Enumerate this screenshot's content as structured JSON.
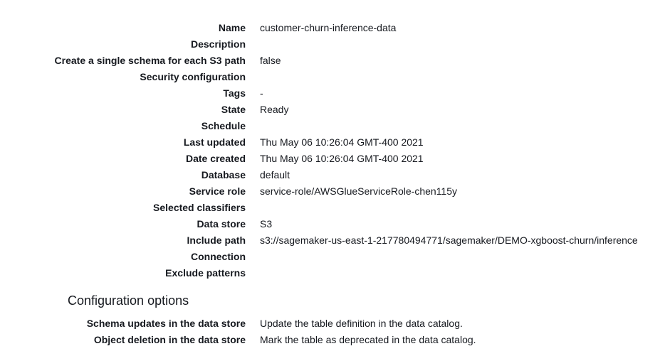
{
  "crawler_details": {
    "rows": [
      {
        "label": "Name",
        "value": "customer-churn-inference-data"
      },
      {
        "label": "Description",
        "value": ""
      },
      {
        "label": "Create a single schema for each S3 path",
        "value": "false"
      },
      {
        "label": "Security configuration",
        "value": ""
      },
      {
        "label": "Tags",
        "value": "-"
      },
      {
        "label": "State",
        "value": "Ready"
      },
      {
        "label": "Schedule",
        "value": ""
      },
      {
        "label": "Last updated",
        "value": "Thu May 06 10:26:04 GMT-400 2021"
      },
      {
        "label": "Date created",
        "value": "Thu May 06 10:26:04 GMT-400 2021"
      },
      {
        "label": "Database",
        "value": "default"
      },
      {
        "label": "Service role",
        "value": "service-role/AWSGlueServiceRole-chen115y"
      },
      {
        "label": "Selected classifiers",
        "value": ""
      },
      {
        "label": "Data store",
        "value": "S3"
      },
      {
        "label": "Include path",
        "value": "s3://sagemaker-us-east-1-217780494771/sagemaker/DEMO-xgboost-churn/inference"
      },
      {
        "label": "Connection",
        "value": ""
      },
      {
        "label": "Exclude patterns",
        "value": ""
      }
    ]
  },
  "configuration_options": {
    "title": "Configuration options",
    "rows": [
      {
        "label": "Schema updates in the data store",
        "value": "Update the table definition in the data catalog."
      },
      {
        "label": "Object deletion in the data store",
        "value": "Mark the table as deprecated in the data catalog."
      }
    ]
  }
}
